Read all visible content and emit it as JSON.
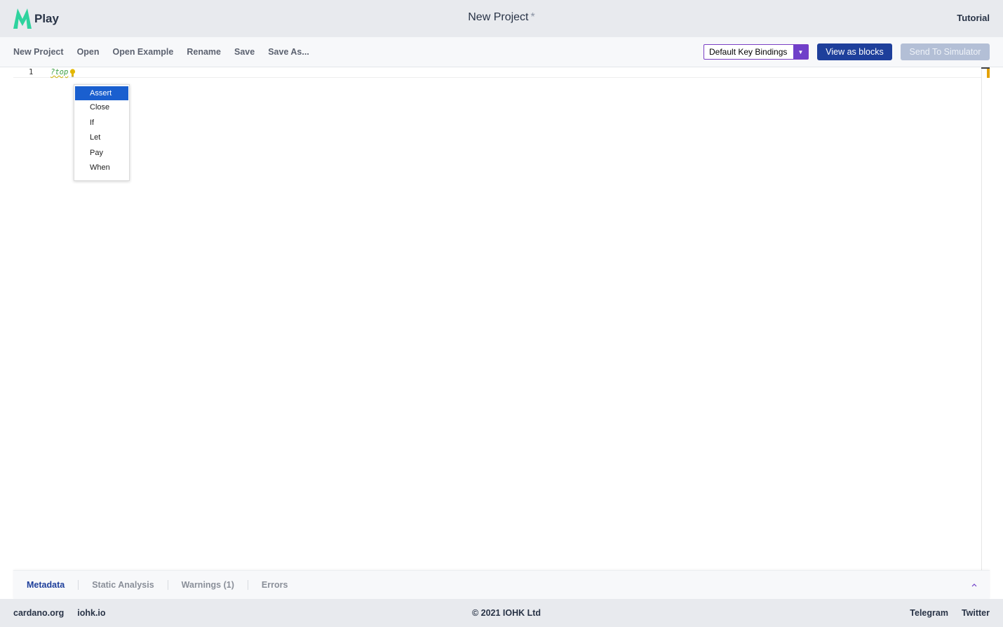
{
  "app": {
    "logo_text": "Play",
    "project_title": "New Project",
    "dirty_marker": "*",
    "tutorial_link": "Tutorial"
  },
  "toolbar": {
    "menu": [
      "New Project",
      "Open",
      "Open Example",
      "Rename",
      "Save",
      "Save As..."
    ],
    "key_bindings": "Default Key Bindings",
    "view_as_blocks": "View as blocks",
    "send_to_simulator": "Send To Simulator"
  },
  "editor": {
    "line_number": "1",
    "code_text": "?top",
    "autocomplete": [
      "Assert",
      "Close",
      "If",
      "Let",
      "Pay",
      "When"
    ],
    "autocomplete_selected": "Assert"
  },
  "bottom_tabs": [
    "Metadata",
    "Static Analysis",
    "Warnings (1)",
    "Errors"
  ],
  "footer": {
    "left_links": [
      "cardano.org",
      "iohk.io"
    ],
    "copyright": "© 2021 IOHK Ltd",
    "right_links": [
      "Telegram",
      "Twitter"
    ]
  },
  "colors": {
    "brand_green": "#2ed39e",
    "primary_blue": "#1e3f9b",
    "accent_purple": "#6f3fc9",
    "disabled_button": "#b3bfd6",
    "selection_blue": "#1a5fcf",
    "warning_marker": "#e4a200"
  }
}
